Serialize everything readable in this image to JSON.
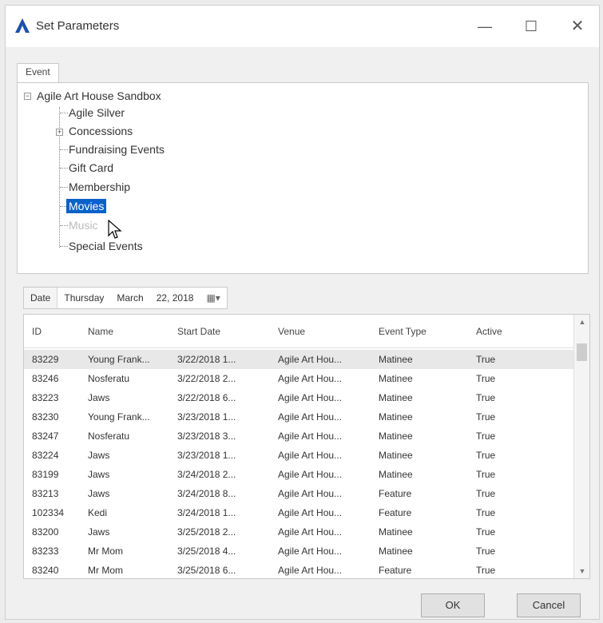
{
  "window": {
    "title": "Set Parameters",
    "minimize_glyph": "—",
    "maximize_glyph": "☐",
    "close_glyph": "✕"
  },
  "tab": {
    "label": "Event"
  },
  "tree": {
    "root": "Agile Art House Sandbox",
    "items": [
      "Agile Silver",
      "Concessions",
      "Fundraising Events",
      "Gift Card",
      "Membership",
      "Movies",
      "Music",
      "Special Events"
    ],
    "selected": "Movies"
  },
  "date_picker": {
    "label": "Date",
    "weekday": "Thursday",
    "month": "March",
    "day_year": "22, 2018",
    "calendar_glyph": "▦▾"
  },
  "grid": {
    "columns": [
      "ID",
      "Name",
      "Start Date",
      "Venue",
      "Event Type",
      "Active"
    ],
    "rows": [
      [
        "83229",
        "Young Frank...",
        "3/22/2018 1...",
        "Agile Art Hou...",
        "Matinee",
        "True"
      ],
      [
        "83246",
        "Nosferatu",
        "3/22/2018 2...",
        "Agile Art Hou...",
        "Matinee",
        "True"
      ],
      [
        "83223",
        "Jaws",
        "3/22/2018 6...",
        "Agile Art Hou...",
        "Matinee",
        "True"
      ],
      [
        "83230",
        "Young Frank...",
        "3/23/2018 1...",
        "Agile Art Hou...",
        "Matinee",
        "True"
      ],
      [
        "83247",
        "Nosferatu",
        "3/23/2018 3...",
        "Agile Art Hou...",
        "Matinee",
        "True"
      ],
      [
        "83224",
        "Jaws",
        "3/23/2018 1...",
        "Agile Art Hou...",
        "Matinee",
        "True"
      ],
      [
        "83199",
        "Jaws",
        "3/24/2018 2...",
        "Agile Art Hou...",
        "Matinee",
        "True"
      ],
      [
        "83213",
        "Jaws",
        "3/24/2018 8...",
        "Agile Art Hou...",
        "Feature",
        "True"
      ],
      [
        "102334",
        "Kedi",
        "3/24/2018 1...",
        "Agile Art Hou...",
        "Feature",
        "True"
      ],
      [
        "83200",
        "Jaws",
        "3/25/2018 2...",
        "Agile Art Hou...",
        "Matinee",
        "True"
      ],
      [
        "83233",
        "Mr Mom",
        "3/25/2018 4...",
        "Agile Art Hou...",
        "Matinee",
        "True"
      ],
      [
        "83240",
        "Mr Mom",
        "3/25/2018 6...",
        "Agile Art Hou...",
        "Feature",
        "True"
      ]
    ]
  },
  "buttons": {
    "ok": "OK",
    "cancel": "Cancel"
  },
  "colors": {
    "selection": "#0a62c9",
    "app_icon": "#1f4fa8"
  }
}
